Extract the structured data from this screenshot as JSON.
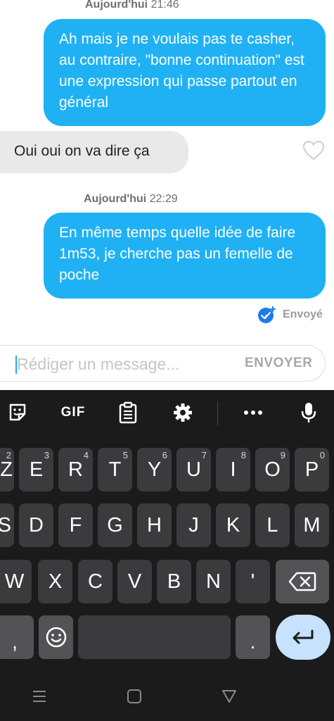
{
  "messages": [
    {
      "type": "timestamp",
      "day": "Aujourd'hui",
      "time": "21:46"
    },
    {
      "type": "outgoing",
      "text": "Ah mais je ne voulais pas te casher, au contraire, \"bonne continuation\" est une expression qui passe partout en général"
    },
    {
      "type": "incoming",
      "text": "Oui oui on va dire ça"
    },
    {
      "type": "timestamp",
      "day": "Aujourd'hui",
      "time": "22:29"
    },
    {
      "type": "outgoing",
      "text": "En même temps quelle idée de faire 1m53, je cherche pas un femelle de poche"
    }
  ],
  "status": {
    "label": "Envoyé"
  },
  "composer": {
    "placeholder": "Rédiger un message...",
    "value": "",
    "send_label": "ENVOYER"
  },
  "keyboard": {
    "toolbar": {
      "gif_label": "GIF"
    },
    "rows": [
      [
        {
          "k": "Z",
          "h": "2"
        },
        {
          "k": "E",
          "h": "3"
        },
        {
          "k": "R",
          "h": "4"
        },
        {
          "k": "T",
          "h": "5"
        },
        {
          "k": "Y",
          "h": "6"
        },
        {
          "k": "U",
          "h": "7"
        },
        {
          "k": "I",
          "h": "8"
        },
        {
          "k": "O",
          "h": "9"
        },
        {
          "k": "P",
          "h": "0"
        }
      ],
      [
        {
          "k": "S"
        },
        {
          "k": "D"
        },
        {
          "k": "F"
        },
        {
          "k": "G"
        },
        {
          "k": "H"
        },
        {
          "k": "J"
        },
        {
          "k": "K"
        },
        {
          "k": "L"
        },
        {
          "k": "M"
        }
      ],
      [
        {
          "k": "W"
        },
        {
          "k": "X"
        },
        {
          "k": "C"
        },
        {
          "k": "V"
        },
        {
          "k": "B"
        },
        {
          "k": "N"
        },
        {
          "k": "'"
        }
      ],
      [
        {
          "k": ","
        },
        {
          "k": "."
        }
      ]
    ]
  },
  "colors": {
    "accent": "#1fb1f3",
    "incoming_bubble": "#e9e9ea",
    "keyboard_bg": "#1b1b1c",
    "key_bg": "#3b3b3d",
    "enter_bg": "#c6e2ff"
  }
}
